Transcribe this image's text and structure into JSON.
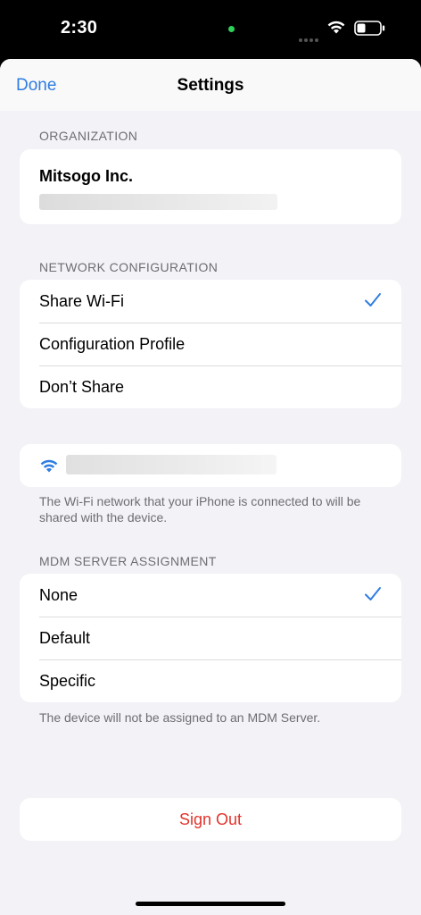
{
  "status": {
    "time": "2:30"
  },
  "nav": {
    "done_label": "Done",
    "title": "Settings"
  },
  "organization": {
    "header": "ORGANIZATION",
    "name": "Mitsogo Inc."
  },
  "network": {
    "header": "NETWORK CONFIGURATION",
    "options": [
      {
        "label": "Share Wi-Fi",
        "selected": true
      },
      {
        "label": "Configuration Profile",
        "selected": false
      },
      {
        "label": "Don’t Share",
        "selected": false
      }
    ],
    "wifi_icon": "wifi-icon",
    "footer": "The Wi-Fi network that your iPhone is connected to will be shared with the device."
  },
  "mdm": {
    "header": "MDM SERVER ASSIGNMENT",
    "options": [
      {
        "label": "None",
        "selected": true
      },
      {
        "label": "Default",
        "selected": false
      },
      {
        "label": "Specific",
        "selected": false
      }
    ],
    "footer": "The device will not be assigned to an MDM Server."
  },
  "sign_out_label": "Sign Out",
  "colors": {
    "accent": "#2f7de1",
    "destructive": "#e2332d",
    "background": "#f2f2f7"
  }
}
